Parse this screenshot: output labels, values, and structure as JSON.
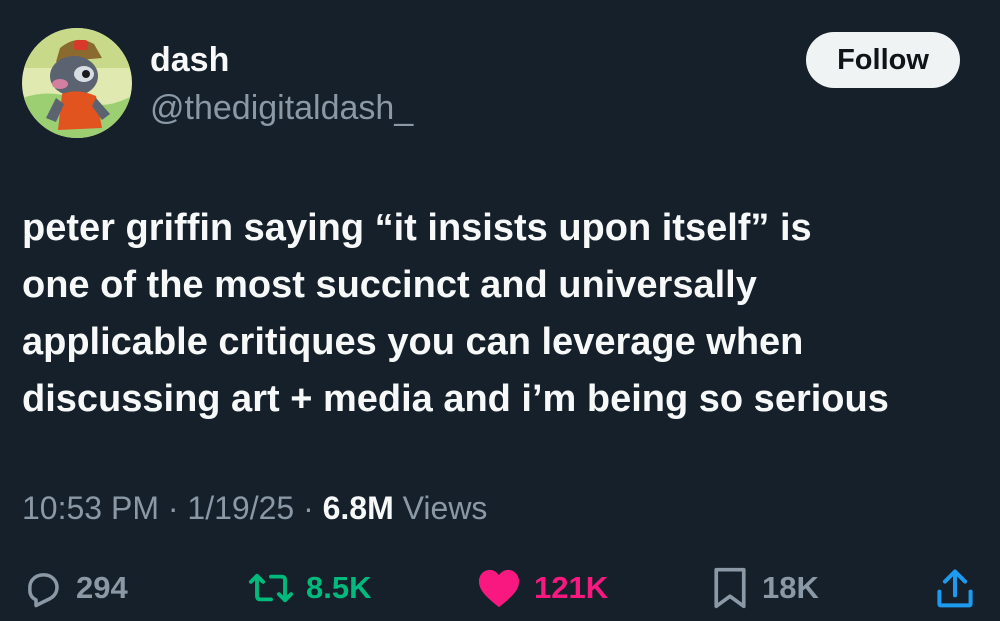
{
  "user": {
    "display_name": "dash",
    "handle": "@thedigitaldash_",
    "follow_label": "Follow"
  },
  "tweet": {
    "text": "peter griffin saying “it insists upon itself” is\none of the most succinct and universally\napplicable critiques you can leverage when\ndiscussing art + media and i’m being so serious"
  },
  "meta": {
    "time": "10:53 PM",
    "separator": "·",
    "date": "1/19/25",
    "views_count": "6.8M",
    "views_label": "Views"
  },
  "actions": {
    "reply": {
      "icon": "reply-icon",
      "count": "294",
      "color": "#8b98a5"
    },
    "retweet": {
      "icon": "retweet-icon",
      "count": "8.5K",
      "color": "#00ba7c"
    },
    "like": {
      "icon": "heart-icon",
      "count": "121K",
      "color": "#f91880"
    },
    "bookmark": {
      "icon": "bookmark-icon",
      "count": "18K",
      "color": "#8b98a5"
    },
    "share": {
      "icon": "share-icon",
      "color": "#1d9bf0"
    }
  },
  "theme": {
    "background": "#15202b",
    "text": "#f7f9f9",
    "muted": "#8b98a5"
  }
}
